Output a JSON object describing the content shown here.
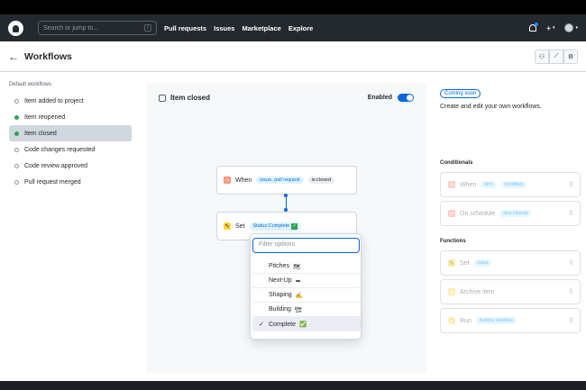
{
  "header": {
    "search_placeholder": "Search or jump to...",
    "search_shortcut": "/",
    "nav": [
      "Pull requests",
      "Issues",
      "Marketplace",
      "Explore"
    ],
    "plus": "+",
    "caret": "▾"
  },
  "page": {
    "back": "←",
    "title": "Workflows",
    "toolbar_icons": [
      "⚇",
      "⟋",
      "⚙"
    ]
  },
  "sidebar": {
    "heading": "Default workflows",
    "items": [
      {
        "label": "Item added to project",
        "enabled": false
      },
      {
        "label": "Item reopened",
        "enabled": true
      },
      {
        "label": "Item closed",
        "enabled": true,
        "active": true
      },
      {
        "label": "Code changes requested",
        "enabled": false
      },
      {
        "label": "Code review approved",
        "enabled": false
      },
      {
        "label": "Pull request merged",
        "enabled": false
      }
    ]
  },
  "canvas": {
    "title": "Item closed",
    "enabled_label": "Enabled",
    "enabled": true,
    "when_node": {
      "label": "When",
      "chip1": "issue, pull request",
      "chip2": "is:closed"
    },
    "set_node": {
      "label": "Set",
      "chip": "Status:Complete"
    }
  },
  "dropdown": {
    "filter_placeholder": "Filter options",
    "options": [
      {
        "label": "Pitches",
        "emoji": "🗺",
        "selected": false
      },
      {
        "label": "Next-Up",
        "emoji": "➡",
        "selected": false
      },
      {
        "label": "Shaping",
        "emoji": "✍",
        "selected": false
      },
      {
        "label": "Building",
        "emoji": "🏗",
        "selected": false
      },
      {
        "label": "Complete",
        "emoji": "✅",
        "selected": true
      }
    ],
    "check": "✓"
  },
  "right_panel": {
    "badge": "Coming soon",
    "description": "Create and edit your own workflows.",
    "conditionals_heading": "Conditionals",
    "conditionals": [
      {
        "label": "When",
        "chip1": "item",
        "chip2": "condition"
      },
      {
        "label": "On schedule",
        "chip1": "time interval"
      }
    ],
    "functions_heading": "Functions",
    "functions": [
      {
        "label": "Set",
        "chip1": "value"
      },
      {
        "label": "Archive item"
      },
      {
        "label": "Run",
        "chip1": "Actions workflow"
      }
    ],
    "grip": "⠿"
  },
  "colors": {
    "accent": "#0969da",
    "success": "#2da44e",
    "header_bg": "#24292f"
  }
}
